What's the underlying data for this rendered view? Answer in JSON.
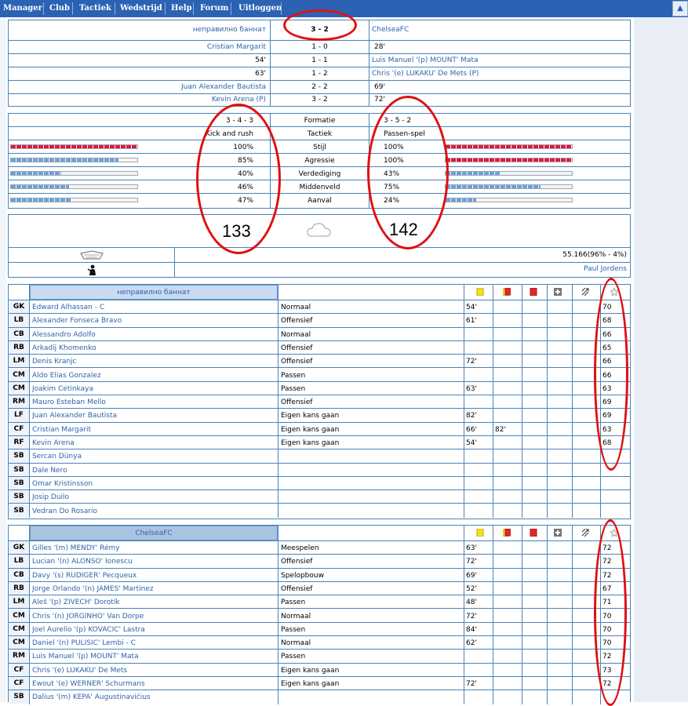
{
  "nav": {
    "items": [
      "Manager",
      "Club",
      "Tactiek",
      "Wedstrijd",
      "Help",
      "Forum",
      "Uitloggen"
    ],
    "up_arrow": "▲"
  },
  "score": {
    "home": "неправилно баннат",
    "score": "3 - 2",
    "away": "ChelseaFC",
    "goals": [
      {
        "home_player": "Cristian Margarit",
        "home_min": "",
        "score": "1  -  0",
        "away_min": "28'",
        "away_player": ""
      },
      {
        "home_player": "",
        "home_min": "54'",
        "score": "1  -  1",
        "away_min": "",
        "away_player": "Luis Manuel '(p) MOUNT' Mata"
      },
      {
        "home_player": "",
        "home_min": "63'",
        "score": "1  -  2",
        "away_min": "",
        "away_player": "Chris '(e) LUKAKU' De Mets  (P)"
      },
      {
        "home_player": "Juan Alexander Bautista",
        "home_min": "",
        "score": "2  -  2",
        "away_min": "69'",
        "away_player": ""
      },
      {
        "home_player": "Kevin Arena  (P)",
        "home_min": "",
        "score": "3  -  2",
        "away_min": "72'",
        "away_player": ""
      }
    ]
  },
  "tactics": {
    "rows": [
      {
        "home": "3 - 4 - 3",
        "label": "Formatie",
        "away": "3 - 5 - 2",
        "home_bar": null,
        "away_bar": null
      },
      {
        "home": "Kick and rush",
        "label": "Tactiek",
        "away": "Passen-spel",
        "home_bar": null,
        "away_bar": null
      },
      {
        "home": "100%",
        "label": "Stijl",
        "away": "100%",
        "home_bar": 1.0,
        "away_bar": 1.0,
        "home_color": "red",
        "away_color": "red"
      },
      {
        "home": "85%",
        "label": "Agressie",
        "away": "100%",
        "home_bar": 0.85,
        "away_bar": 1.0,
        "home_color": "blue",
        "away_color": "red"
      },
      {
        "home": "40%",
        "label": "Verdediging",
        "away": "43%",
        "home_bar": 0.4,
        "away_bar": 0.43,
        "home_color": "blue",
        "away_color": "blue"
      },
      {
        "home": "46%",
        "label": "Middenveld",
        "away": "75%",
        "home_bar": 0.46,
        "away_bar": 0.75,
        "home_color": "blue",
        "away_color": "blue"
      },
      {
        "home": "47%",
        "label": "Aanval",
        "away": "24%",
        "home_bar": 0.47,
        "away_bar": 0.24,
        "home_color": "blue",
        "away_color": "blue"
      }
    ]
  },
  "annotations": {
    "home_total": "133",
    "away_total": "142"
  },
  "weather": {
    "icon": "cloud-icon"
  },
  "attendance": {
    "icon": "stadium-icon",
    "value": "55.166(96% - 4%)"
  },
  "referee": {
    "icon": "referee-icon",
    "name": "Paul Jordens"
  },
  "lineup_icons": [
    "yellow-card-icon",
    "yellow-red-card-icon",
    "red-card-icon",
    "injury-icon",
    "substitution-icon",
    "rating-star-icon"
  ],
  "home_lineup": {
    "team": "неправилно баннат",
    "players": [
      {
        "pos": "GK",
        "name": "Edward Alhassan  - C",
        "role": "Normaal",
        "y1": "54'",
        "y2": "",
        "rating": "70"
      },
      {
        "pos": "LB",
        "name": "Alexander Fonseca Bravo",
        "role": "Offensief",
        "y1": "61'",
        "y2": "",
        "rating": "68"
      },
      {
        "pos": "CB",
        "name": "Alessandro Adolfo",
        "role": "Normaal",
        "y1": "",
        "y2": "",
        "rating": "66"
      },
      {
        "pos": "RB",
        "name": "Arkadij Khomenko",
        "role": "Offensief",
        "y1": "",
        "y2": "",
        "rating": "65"
      },
      {
        "pos": "LM",
        "name": "Denis Kranjc",
        "role": "Offensief",
        "y1": "72'",
        "y2": "",
        "rating": "66"
      },
      {
        "pos": "CM",
        "name": "Aldo Elias Gonzalez",
        "role": "Passen",
        "y1": "",
        "y2": "",
        "rating": "66"
      },
      {
        "pos": "CM",
        "name": "Joakim Cetinkaya",
        "role": "Passen",
        "y1": "63'",
        "y2": "",
        "rating": "63"
      },
      {
        "pos": "RM",
        "name": "Mauro Esteban Mello",
        "role": "Offensief",
        "y1": "",
        "y2": "",
        "rating": "69"
      },
      {
        "pos": "LF",
        "name": "Juan Alexander Bautista",
        "role": "Eigen kans gaan",
        "y1": "82'",
        "y2": "",
        "rating": "69"
      },
      {
        "pos": "CF",
        "name": "Cristian Margarit",
        "role": "Eigen kans gaan",
        "y1": "66'",
        "y2": "82'",
        "rating": "63"
      },
      {
        "pos": "RF",
        "name": "Kevin Arena",
        "role": "Eigen kans gaan",
        "y1": "54'",
        "y2": "",
        "rating": "68"
      },
      {
        "pos": "SB",
        "name": "Sercan Dünya",
        "role": "",
        "y1": "",
        "y2": "",
        "rating": ""
      },
      {
        "pos": "SB",
        "name": "Dale Nero",
        "role": "",
        "y1": "",
        "y2": "",
        "rating": ""
      },
      {
        "pos": "SB",
        "name": "Omar Kristinsson",
        "role": "",
        "y1": "",
        "y2": "",
        "rating": ""
      },
      {
        "pos": "SB",
        "name": "Josip Duilo",
        "role": "",
        "y1": "",
        "y2": "",
        "rating": ""
      },
      {
        "pos": "SB",
        "name": "Vedran Do Rosario",
        "role": "",
        "y1": "",
        "y2": "",
        "rating": ""
      }
    ]
  },
  "away_lineup": {
    "team": "ChelseaFC",
    "players": [
      {
        "pos": "GK",
        "name": "Gilles '(m) MENDY' Rémy",
        "role": "Meespelen",
        "y1": "63'",
        "y2": "",
        "rating": "72"
      },
      {
        "pos": "LB",
        "name": "Lucian '(n) ALONSO' Ionescu",
        "role": "Offensief",
        "y1": "72'",
        "y2": "",
        "rating": "72"
      },
      {
        "pos": "CB",
        "name": "Davy '(s) RUDIGER' Pecqueux",
        "role": "Spelopbouw",
        "y1": "69'",
        "y2": "",
        "rating": "72"
      },
      {
        "pos": "RB",
        "name": "Jorge Orlando '(n) JAMES' Martinez",
        "role": "Offensief",
        "y1": "52'",
        "y2": "",
        "rating": "67"
      },
      {
        "pos": "LM",
        "name": "Aleš '(p) ZIVECH' Dorotík",
        "role": "Passen",
        "y1": "48'",
        "y2": "",
        "rating": "71"
      },
      {
        "pos": "CM",
        "name": "Chris '(n) JORGINHO' Van Dorpe",
        "role": "Normaal",
        "y1": "72'",
        "y2": "",
        "rating": "70"
      },
      {
        "pos": "CM",
        "name": "Joel Aurelio '(p) KOVACIC' Lastra",
        "role": "Passen",
        "y1": "84'",
        "y2": "",
        "rating": "70"
      },
      {
        "pos": "CM",
        "name": "Daniel '(n) PULISIC' Lembi  - C",
        "role": "Normaal",
        "y1": "62'",
        "y2": "",
        "rating": "70"
      },
      {
        "pos": "RM",
        "name": "Luis Manuel '(p) MOUNT' Mata",
        "role": "Passen",
        "y1": "",
        "y2": "",
        "rating": "72"
      },
      {
        "pos": "CF",
        "name": "Chris '(e) LUKAKU' De Mets",
        "role": "Eigen kans gaan",
        "y1": "",
        "y2": "",
        "rating": "73"
      },
      {
        "pos": "CF",
        "name": "Ewout '(e) WERNER' Schurmans",
        "role": "Eigen kans gaan",
        "y1": "72'",
        "y2": "",
        "rating": "72"
      },
      {
        "pos": "SB",
        "name": "Dalius '(m) KEPA' Augustinavičius",
        "role": "",
        "y1": "",
        "y2": "",
        "rating": ""
      }
    ]
  }
}
